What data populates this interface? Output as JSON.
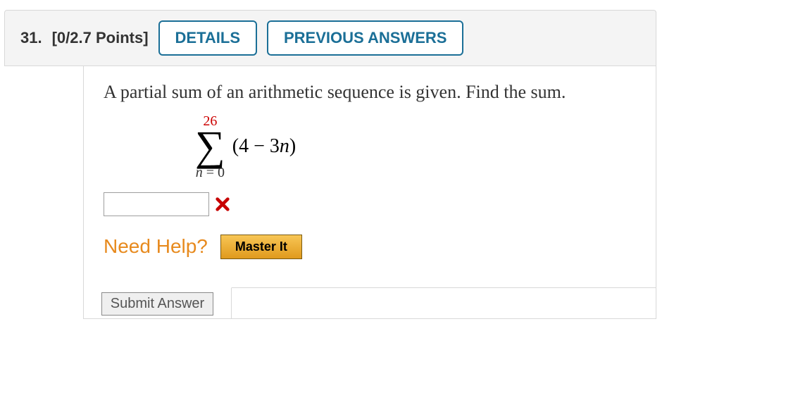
{
  "header": {
    "question_number": "31.",
    "points": "[0/2.7 Points]",
    "details_label": "DETAILS",
    "previous_label": "PREVIOUS ANSWERS"
  },
  "prompt": "A partial sum of an arithmetic sequence is given. Find the sum.",
  "sigma": {
    "upper": "26",
    "symbol": "∑",
    "lower_var": "n",
    "lower_eq": " = 0",
    "term_open": "(4 − 3",
    "term_var": "n",
    "term_close": ")"
  },
  "answer": {
    "value": ""
  },
  "help": {
    "label": "Need Help?",
    "master_label": "Master It"
  },
  "submit_label": "Submit Answer"
}
